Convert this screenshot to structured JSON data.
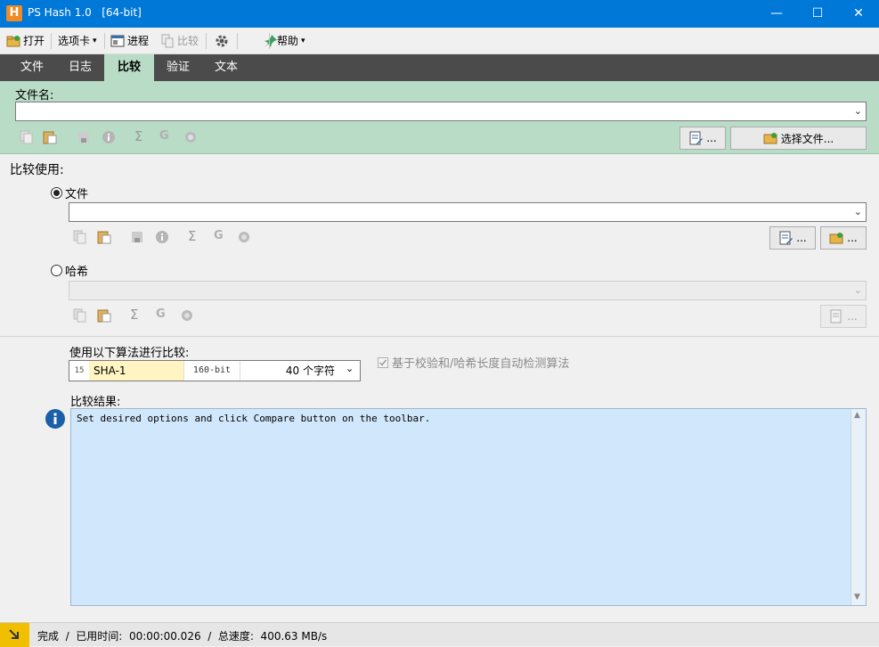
{
  "window": {
    "title": "PS Hash 1.0   [64-bit]",
    "icon_letter": "H",
    "minimize_glyph": "—",
    "maximize_glyph": "☐",
    "close_glyph": "✕"
  },
  "toolbar": {
    "open": "打开",
    "tabs_menu": "选项卡",
    "process": "进程",
    "compare": "比较",
    "help": "帮助",
    "dropdown_arrow": "▾"
  },
  "tabs": [
    "文件",
    "日志",
    "比较",
    "验证",
    "文本"
  ],
  "active_tab": "比较",
  "file_panel": {
    "label": "文件名:",
    "value": "",
    "edit_button": "...",
    "select_button": "选择文件..."
  },
  "compare_with": {
    "heading": "比较使用:",
    "file_option": {
      "label": "文件",
      "checked": true,
      "value": "",
      "edit_button": "...",
      "browse_button": "..."
    },
    "hash_option": {
      "label": "哈希",
      "checked": false,
      "value": "",
      "edit_button": "..."
    }
  },
  "algorithm": {
    "label": "使用以下算法进行比较:",
    "number": "15",
    "name": "SHA-1",
    "bits": "160-bit",
    "chars": "40 个字符",
    "auto_detect_label": "基于校验和/哈希长度自动检测算法",
    "auto_detect_checked": true
  },
  "results": {
    "label": "比较结果:",
    "text": "Set desired options and click Compare button on the toolbar."
  },
  "status": {
    "text": "完成  /  已用时间:  00:00:00.026  /  总速度:  400.63 MB/s"
  },
  "colors": {
    "titlebar": "#0078d7",
    "panel_green": "#b9dcc6",
    "results_bg": "#d1e7fb",
    "algo_highlight": "#fff4c2"
  }
}
